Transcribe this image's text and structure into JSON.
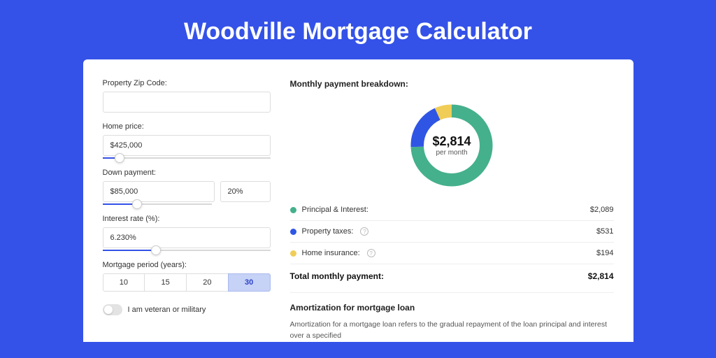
{
  "page": {
    "title": "Woodville Mortgage Calculator"
  },
  "colors": {
    "principal": "#45b08c",
    "taxes": "#2f55e5",
    "insurance": "#f0cd57"
  },
  "form": {
    "zip": {
      "label": "Property Zip Code:",
      "value": ""
    },
    "home_price": {
      "label": "Home price:",
      "value": "$425,000",
      "slider_pct": 10
    },
    "down_payment": {
      "label": "Down payment:",
      "value": "$85,000",
      "pct_value": "20%",
      "slider_pct": 21
    },
    "interest_rate": {
      "label": "Interest rate (%):",
      "value": "6.230%",
      "slider_pct": 32
    },
    "period": {
      "label": "Mortgage period (years):",
      "options": [
        "10",
        "15",
        "20",
        "30"
      ],
      "active": "30"
    },
    "veteran": {
      "label": "I am veteran or military",
      "checked": false
    }
  },
  "breakdown": {
    "title": "Monthly payment breakdown:",
    "center_amount": "$2,814",
    "center_sub": "per month",
    "items": [
      {
        "label": "Principal & Interest:",
        "value": "$2,089",
        "numeric": 2089,
        "info": false,
        "color_key": "principal"
      },
      {
        "label": "Property taxes:",
        "value": "$531",
        "numeric": 531,
        "info": true,
        "color_key": "taxes"
      },
      {
        "label": "Home insurance:",
        "value": "$194",
        "numeric": 194,
        "info": true,
        "color_key": "insurance"
      }
    ],
    "total_label": "Total monthly payment:",
    "total_value": "$2,814",
    "total_numeric": 2814
  },
  "chart_data": {
    "type": "pie",
    "title": "Monthly payment breakdown",
    "series": [
      {
        "name": "Principal & Interest",
        "value": 2089
      },
      {
        "name": "Property taxes",
        "value": 531
      },
      {
        "name": "Home insurance",
        "value": 194
      }
    ],
    "total": 2814
  },
  "amortization": {
    "title": "Amortization for mortgage loan",
    "body": "Amortization for a mortgage loan refers to the gradual repayment of the loan principal and interest over a specified"
  }
}
